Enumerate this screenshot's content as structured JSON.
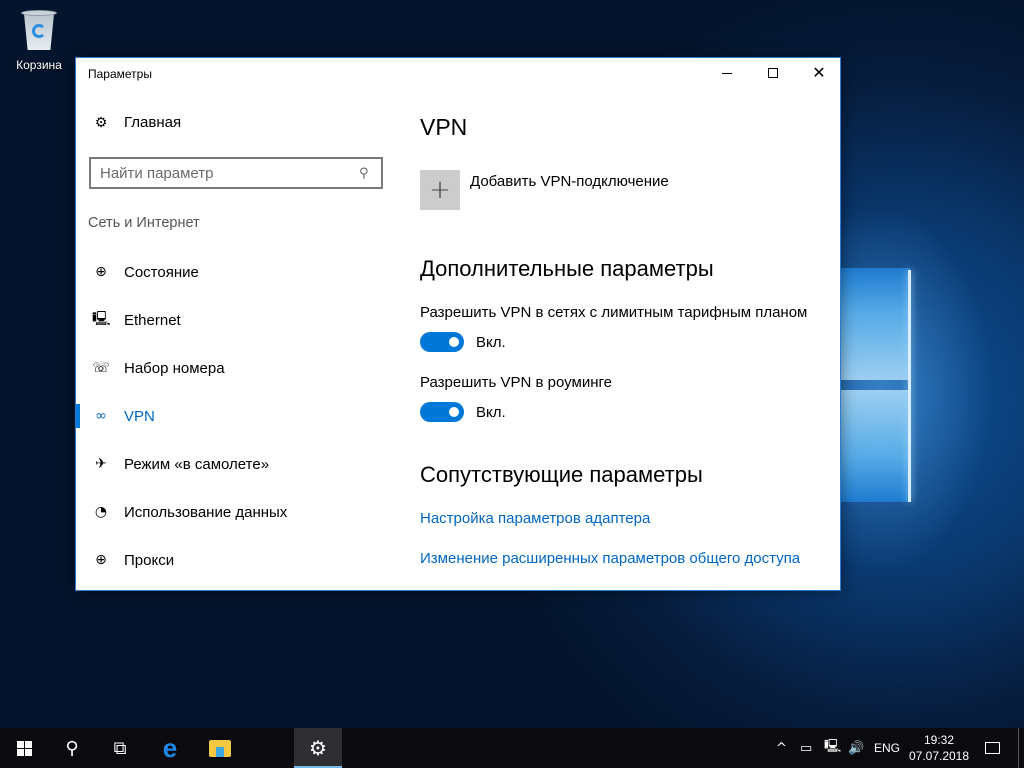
{
  "desktop": {
    "recycle_bin_label": "Корзина"
  },
  "window": {
    "title": "Параметры",
    "controls": {
      "minimize": "—",
      "maximize": "☐",
      "close": "✕"
    }
  },
  "sidebar": {
    "home_label": "Главная",
    "home_icon": "gear-icon",
    "search_placeholder": "Найти параметр",
    "search_value": "",
    "section_label": "Сеть и Интернет",
    "items": [
      {
        "label": "Состояние",
        "icon": "network-status-icon",
        "glyph": "⊕",
        "active": false
      },
      {
        "label": "Ethernet",
        "icon": "ethernet-icon",
        "glyph": "🖳",
        "active": false
      },
      {
        "label": "Набор номера",
        "icon": "dialup-phone-icon",
        "glyph": "☏",
        "active": false
      },
      {
        "label": "VPN",
        "icon": "vpn-icon",
        "glyph": "∞",
        "active": true
      },
      {
        "label": "Режим «в самолете»",
        "icon": "airplane-icon",
        "glyph": "✈",
        "active": false
      },
      {
        "label": "Использование данных",
        "icon": "data-usage-icon",
        "glyph": "◔",
        "active": false
      },
      {
        "label": "Прокси",
        "icon": "globe-icon",
        "glyph": "⊕",
        "active": false
      }
    ]
  },
  "main": {
    "title": "VPN",
    "add_vpn_label": "Добавить VPN-подключение",
    "add_icon": "+",
    "advanced_heading": "Дополнительные параметры",
    "options": [
      {
        "label": "Разрешить VPN в сетях с лимитным тарифным планом",
        "state": "Вкл.",
        "on": true
      },
      {
        "label": "Разрешить VPN в роуминге",
        "state": "Вкл.",
        "on": true
      }
    ],
    "related_heading": "Сопутствующие параметры",
    "links": [
      "Настройка параметров адаптера",
      "Изменение расширенных параметров общего доступа"
    ]
  },
  "taskbar": {
    "pinned": [
      "start",
      "search",
      "task-view",
      "edge",
      "file-explorer",
      "settings"
    ],
    "search_glyph": "⚲",
    "taskview_glyph": "⧉",
    "edge_glyph": "e",
    "settings_glyph": "⚙",
    "tray": {
      "chevron": "^",
      "power_glyph": "▭",
      "network_glyph": "🖳",
      "volume_glyph": "🔊",
      "language": "ENG"
    },
    "time": "19:32",
    "date": "07.07.2018"
  },
  "colors": {
    "accent": "#0078d7",
    "link": "#0067c0",
    "taskbar": "#0b0b0f"
  }
}
